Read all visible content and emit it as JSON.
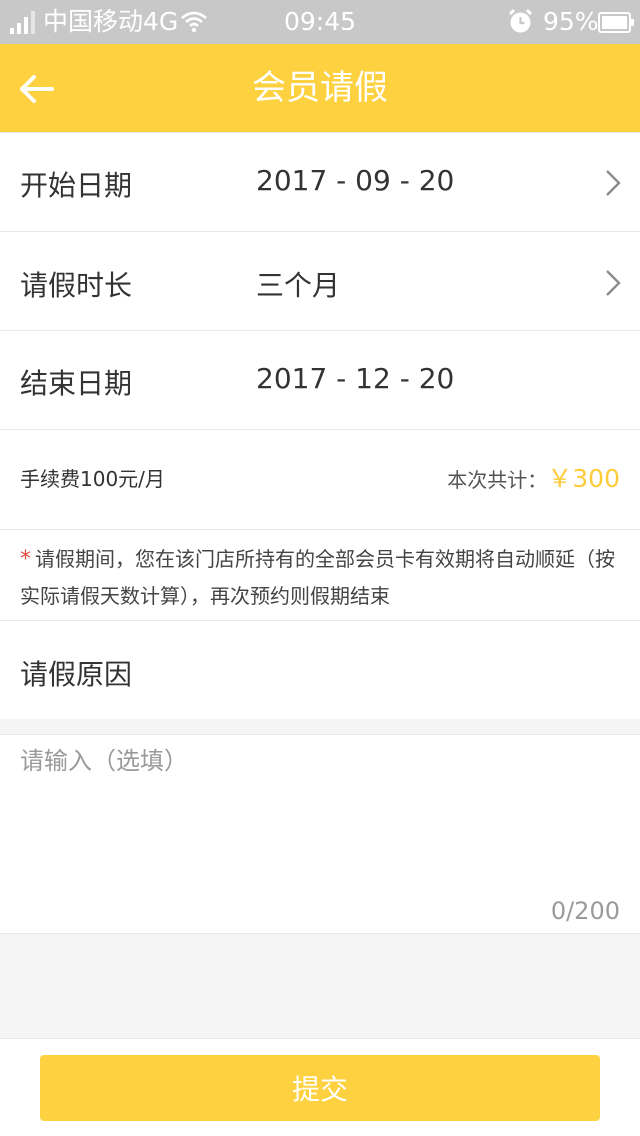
{
  "status_bar": {
    "carrier": "中国移动4G",
    "time": "09:45",
    "battery": "95%"
  },
  "header": {
    "title": "会员请假",
    "back_icon": "arrow-left-icon"
  },
  "form": {
    "start_date": {
      "label": "开始日期",
      "value": "2017 - 09 - 20"
    },
    "duration": {
      "label": "请假时长",
      "value": "三个月"
    },
    "end_date": {
      "label": "结束日期",
      "value": "2017 - 12 - 20"
    },
    "fee": {
      "label": "手续费100元/月",
      "total_label": "本次共计：",
      "total_value": "￥300"
    },
    "notice": {
      "star": "*",
      "text": "请假期间，您在该门店所持有的全部会员卡有效期将自动顺延（按实际请假天数计算），再次预约则假期结束"
    },
    "reason": {
      "title": "请假原因",
      "placeholder": "请输入（选填）",
      "value": "",
      "counter": "0/200"
    }
  },
  "submit_label": "提交",
  "colors": {
    "accent": "#fed140",
    "price": "#fecb3a",
    "required": "#e24b3b",
    "status_bar": "#c8c8c8"
  }
}
